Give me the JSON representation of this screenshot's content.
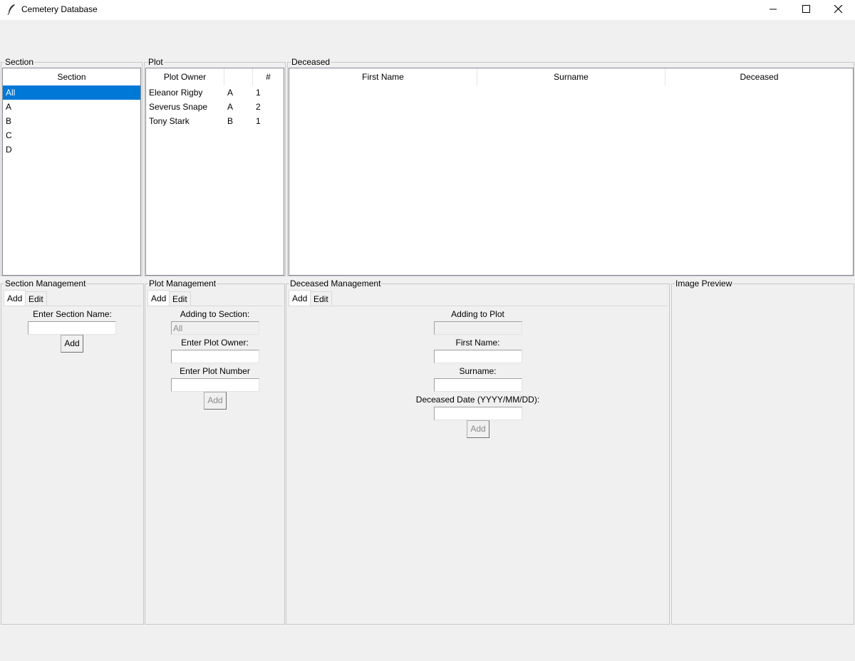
{
  "window": {
    "title": "Cemetery Database",
    "icon": "feather-icon"
  },
  "section_panel": {
    "label": "Section",
    "header": "Section",
    "items": [
      {
        "label": "All",
        "selected": true
      },
      {
        "label": "A",
        "selected": false
      },
      {
        "label": "B",
        "selected": false
      },
      {
        "label": "C",
        "selected": false
      },
      {
        "label": "D",
        "selected": false
      }
    ]
  },
  "plot_panel": {
    "label": "Plot",
    "columns": [
      "Plot Owner",
      "",
      "#"
    ],
    "rows": [
      {
        "owner": "Eleanor Rigby",
        "section": "A",
        "number": "1"
      },
      {
        "owner": "Severus Snape",
        "section": "A",
        "number": "2"
      },
      {
        "owner": "Tony Stark",
        "section": "B",
        "number": "1"
      }
    ]
  },
  "deceased_panel": {
    "label": "Deceased",
    "columns": [
      "First Name",
      "Surname",
      "Deceased"
    ],
    "rows": []
  },
  "section_management": {
    "label": "Section Management",
    "tabs": [
      "Add",
      "Edit"
    ],
    "name_label": "Enter Section Name:",
    "name_value": "",
    "add_button": "Add"
  },
  "plot_management": {
    "label": "Plot Management",
    "tabs": [
      "Add",
      "Edit"
    ],
    "section_label": "Adding to Section:",
    "section_value": "All",
    "owner_label": "Enter Plot Owner:",
    "owner_value": "",
    "number_label": "Enter Plot Number",
    "number_value": "",
    "add_button": "Add"
  },
  "deceased_management": {
    "label": "Deceased Management",
    "tabs": [
      "Add",
      "Edit"
    ],
    "plot_label": "Adding to Plot",
    "plot_value": "",
    "first_name_label": "First Name:",
    "first_name_value": "",
    "surname_label": "Surname:",
    "surname_value": "",
    "date_label": "Deceased Date (YYYY/MM/DD):",
    "date_value": "",
    "add_button": "Add"
  },
  "image_preview": {
    "label": "Image Preview"
  },
  "colors": {
    "selection": "#0078d7",
    "background": "#f0f0f0"
  }
}
